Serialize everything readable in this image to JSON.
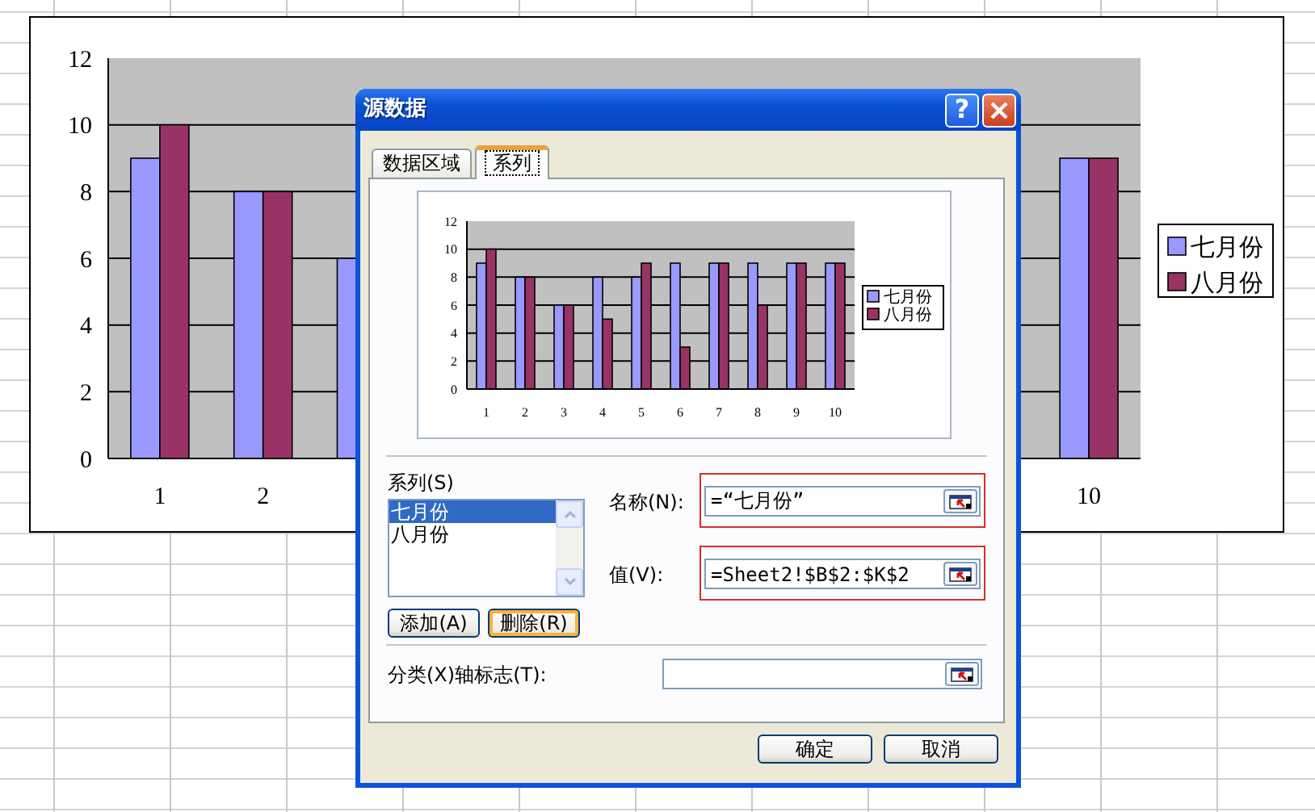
{
  "sheet_chart": {
    "chart_data": {
      "type": "bar",
      "categories": [
        "1",
        "2",
        null,
        null,
        null,
        null,
        null,
        null,
        null,
        "10"
      ],
      "series": [
        {
          "name": "七月份",
          "color": "#9999ff",
          "values": [
            9,
            8,
            6,
            null,
            null,
            null,
            null,
            null,
            null,
            9
          ]
        },
        {
          "name": "八月份",
          "color": "#993366",
          "values": [
            10,
            8,
            null,
            null,
            null,
            null,
            null,
            null,
            null,
            9
          ]
        }
      ],
      "ylim": [
        0,
        12
      ],
      "yticks": [
        0,
        2,
        4,
        6,
        8,
        10,
        12
      ],
      "grid": true,
      "legend": true
    }
  },
  "dialog": {
    "title": "源数据",
    "help_glyph": "?",
    "tabs": [
      {
        "label": "数据区域",
        "selected": false
      },
      {
        "label": "系列",
        "selected": true
      }
    ],
    "chart_data": {
      "type": "bar",
      "categories": [
        "1",
        "2",
        "3",
        "4",
        "5",
        "6",
        "7",
        "8",
        "9",
        "10"
      ],
      "series": [
        {
          "name": "七月份",
          "color": "#9999ff",
          "values": [
            9,
            8,
            6,
            8,
            8,
            9,
            9,
            9,
            9,
            9
          ]
        },
        {
          "name": "八月份",
          "color": "#993366",
          "values": [
            10,
            8,
            6,
            5,
            9,
            3,
            9,
            6,
            9,
            9
          ]
        }
      ],
      "ylim": [
        0,
        12
      ],
      "yticks": [
        0,
        2,
        4,
        6,
        8,
        10,
        12
      ],
      "grid": true,
      "legend": true
    },
    "series_label": "系列(S)",
    "series_list": [
      {
        "label": "七月份",
        "selected": true
      },
      {
        "label": "八月份",
        "selected": false
      }
    ],
    "list_buttons": [
      {
        "label": "添加(A)",
        "hover": false
      },
      {
        "label": "删除(R)",
        "hover": true
      }
    ],
    "fields": [
      {
        "label": "名称(N):",
        "value": "=“七月份”",
        "highlighted": true
      },
      {
        "label": "值(V):",
        "value": "=Sheet2!$B$2:$K$2",
        "highlighted": true
      },
      {
        "label": "分类(X)轴标志(T):",
        "highlighted": false
      }
    ],
    "buttons": [
      "确定",
      "取消"
    ]
  }
}
